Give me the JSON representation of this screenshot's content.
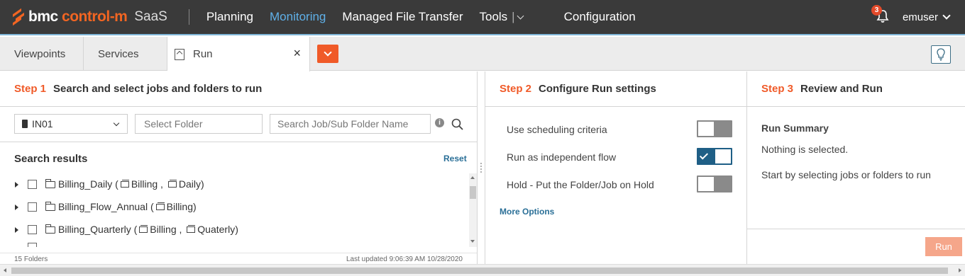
{
  "header": {
    "brand_bmc": "bmc",
    "brand_product": "control-m",
    "brand_saas": "SaaS",
    "nav": [
      "Planning",
      "Monitoring",
      "Managed File Transfer",
      "Tools",
      "Configuration"
    ],
    "active_nav": "Monitoring",
    "tools_separator": "|",
    "notification_count": "3",
    "user": "emuser"
  },
  "tabs": {
    "viewpoints": "Viewpoints",
    "services": "Services",
    "run": "Run",
    "close": "×"
  },
  "step1": {
    "num": "Step 1",
    "title": "Search and select jobs and folders to run",
    "server": "IN01",
    "folder_placeholder": "Select Folder",
    "job_placeholder": "Search Job/Sub Folder Name",
    "info": "i",
    "results_title": "Search results",
    "reset": "Reset",
    "results": [
      {
        "name": "Billing_Daily (",
        "tags": [
          {
            "label": "Billing",
            "sep": " , "
          },
          {
            "label": "Daily",
            "sep": ")"
          }
        ]
      },
      {
        "name": "Billing_Flow_Annual (",
        "tags": [
          {
            "label": "Billing",
            "sep": ")"
          }
        ]
      },
      {
        "name": "Billing_Quarterly (",
        "tags": [
          {
            "label": "Billing",
            "sep": " , "
          },
          {
            "label": "Quaterly",
            "sep": ")"
          }
        ]
      }
    ],
    "count": "15 Folders",
    "last_updated": "Last updated 9:06:39 AM 10/28/2020"
  },
  "step2": {
    "num": "Step 2",
    "title": "Configure Run settings",
    "settings": [
      {
        "label": "Use scheduling criteria",
        "on": false
      },
      {
        "label": "Run as independent flow",
        "on": true
      },
      {
        "label": "Hold - Put the Folder/Job on Hold",
        "on": false
      }
    ],
    "more_options": "More Options"
  },
  "step3": {
    "num": "Step 3",
    "title": "Review and Run",
    "summary_title": "Run Summary",
    "summary_line1": "Nothing is selected.",
    "summary_line2": "Start by selecting jobs or folders to run",
    "run_button": "Run"
  },
  "colors": {
    "accent": "#f05a28",
    "active_nav": "#5fb0e8",
    "link": "#2a6f97",
    "toggle_on": "#1f5f86"
  }
}
